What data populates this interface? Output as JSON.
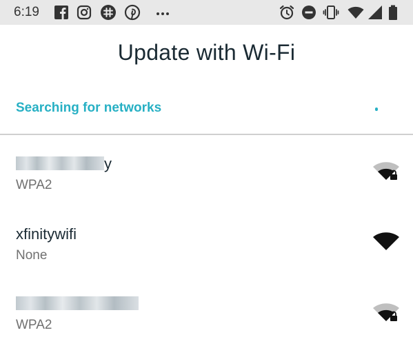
{
  "status_bar": {
    "time": "6:19",
    "left_icons": [
      "facebook-icon",
      "instagram-icon",
      "slack-icon",
      "pinterest-icon",
      "more-notifications-icon"
    ],
    "right_icons": [
      "alarm-icon",
      "do-not-disturb-icon",
      "vibrate-icon",
      "wifi-signal-icon",
      "cell-signal-icon",
      "battery-icon"
    ]
  },
  "header": {
    "title": "Update with Wi-Fi"
  },
  "search": {
    "label": "Searching for networks"
  },
  "networks": [
    {
      "name": "y",
      "security": "WPA2",
      "locked": true,
      "signal": "medium",
      "name_obscured": true
    },
    {
      "name": "xfinitywifi",
      "security": "None",
      "locked": false,
      "signal": "full",
      "name_obscured": false
    },
    {
      "name": "",
      "security": "WPA2",
      "locked": true,
      "signal": "medium",
      "name_obscured": true
    }
  ],
  "colors": {
    "accent": "#27b0c4",
    "title": "#1a2a33",
    "secondary": "#707070",
    "status_bar_bg": "#e8e8e8"
  }
}
